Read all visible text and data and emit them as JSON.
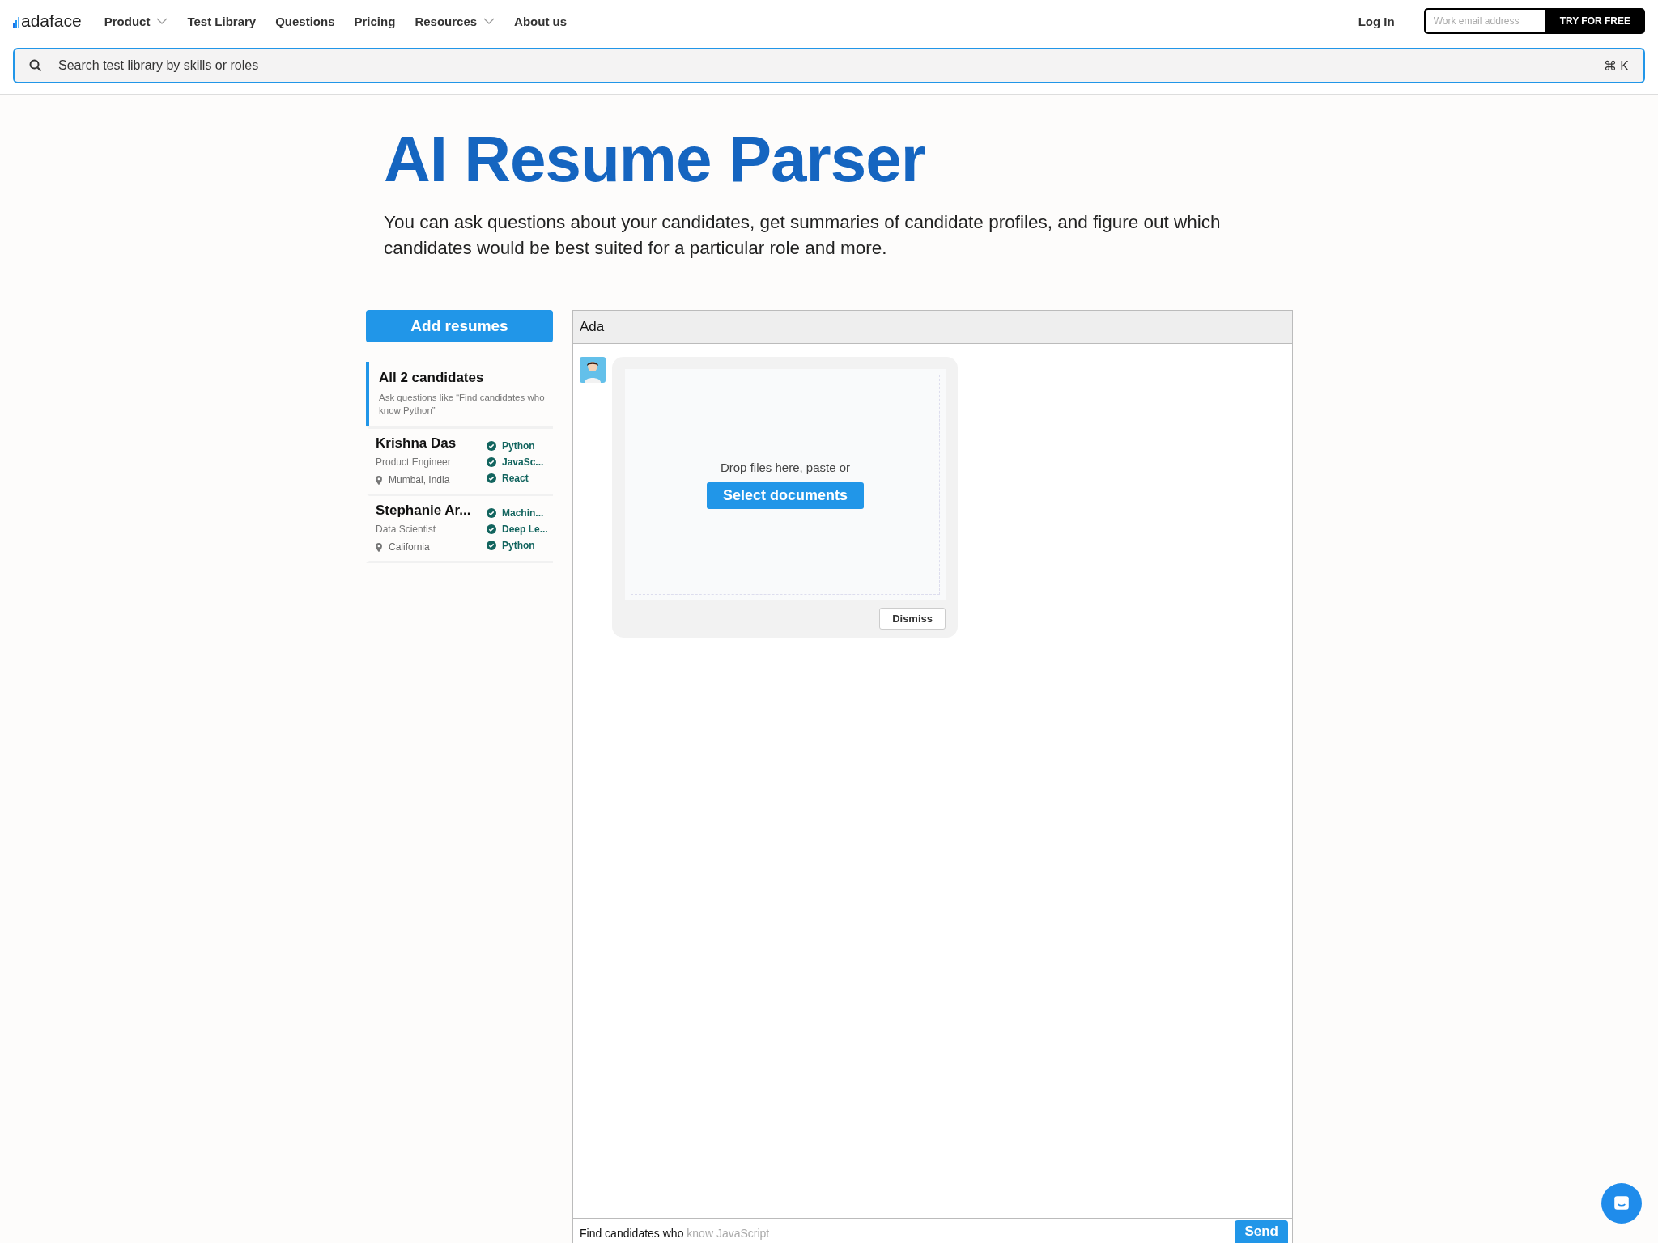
{
  "nav": {
    "logo": "adaface",
    "links": [
      {
        "label": "Product",
        "dropdown": true
      },
      {
        "label": "Test Library",
        "dropdown": false
      },
      {
        "label": "Questions",
        "dropdown": false
      },
      {
        "label": "Pricing",
        "dropdown": false
      },
      {
        "label": "Resources",
        "dropdown": true
      },
      {
        "label": "About us",
        "dropdown": false
      }
    ],
    "login": "Log In",
    "email_placeholder": "Work email address",
    "cta": "TRY FOR FREE"
  },
  "search": {
    "placeholder": "Search test library by skills or roles",
    "shortcut": "⌘ K"
  },
  "hero": {
    "title": "AI Resume Parser",
    "description": "You can ask questions about your candidates, get summaries of candidate profiles, and figure out which candidates would be best suited for a particular role and more."
  },
  "sidebar": {
    "add_button": "Add resumes",
    "items": [
      {
        "kind": "all",
        "selected": true,
        "title": "All 2 candidates",
        "hint": "Ask questions like “Find candidates who know Python”"
      },
      {
        "kind": "candidate",
        "selected": false,
        "name": "Krishna Das",
        "role": "Product Engineer",
        "location": "Mumbai, India",
        "skills": [
          "Python",
          "JavaSc...",
          "React"
        ]
      },
      {
        "kind": "candidate",
        "selected": false,
        "name": "Stephanie Ar...",
        "role": "Data Scientist",
        "location": "California",
        "skills": [
          "Machin...",
          "Deep Le...",
          "Python"
        ]
      }
    ]
  },
  "chat": {
    "title": "Ada",
    "drop_text": "Drop files here, paste or",
    "select_button": "Select documents",
    "dismiss_button": "Dismiss",
    "input_value": "Find candidates who",
    "input_suggestion": "know JavaScript",
    "send_button": "Send"
  }
}
